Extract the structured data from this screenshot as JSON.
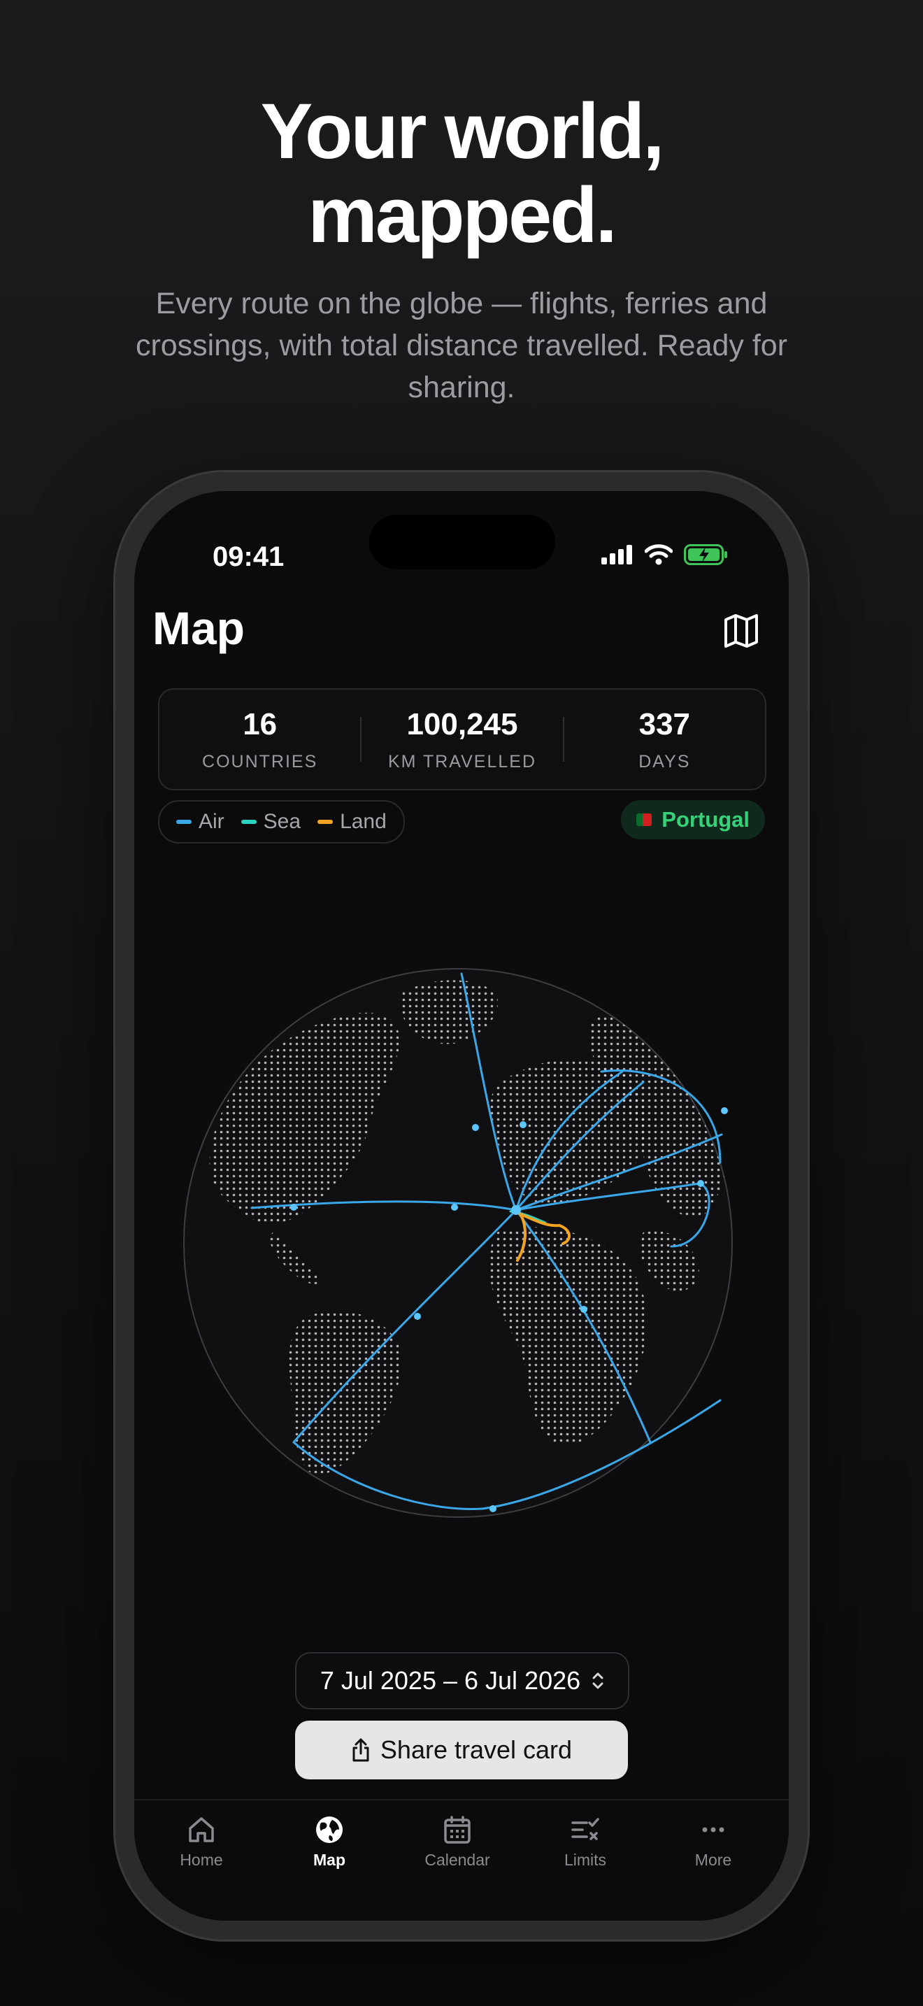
{
  "marketing": {
    "headline_line1": "Your world,",
    "headline_line2": "mapped.",
    "subhead": "Every route on the globe — flights, ferries and crossings, with total distance travelled. Ready for sharing."
  },
  "status_bar": {
    "time": "09:41"
  },
  "header": {
    "title": "Map",
    "toggle_icon": "map-icon"
  },
  "stats": [
    {
      "value": "16",
      "label": "COUNTRIES"
    },
    {
      "value": "100,245",
      "label": "KM TRAVELLED"
    },
    {
      "value": "337",
      "label": "DAYS"
    }
  ],
  "legend": [
    {
      "label": "Air",
      "color": "#3aa8e8"
    },
    {
      "label": "Sea",
      "color": "#2bd3c0"
    },
    {
      "label": "Land",
      "color": "#f2a421"
    }
  ],
  "current_country": {
    "name": "Portugal",
    "color": "#36d27a"
  },
  "date_range": {
    "label": "7 Jul 2025 – 6 Jul 2026"
  },
  "share": {
    "label": "Share travel card",
    "icon": "share-icon"
  },
  "tabs": [
    {
      "label": "Home",
      "icon": "home-icon",
      "active": false
    },
    {
      "label": "Map",
      "icon": "globe-icon",
      "active": true
    },
    {
      "label": "Calendar",
      "icon": "calendar-icon",
      "active": false
    },
    {
      "label": "Limits",
      "icon": "checklist-icon",
      "active": false
    },
    {
      "label": "More",
      "icon": "ellipsis-icon",
      "active": false
    }
  ]
}
